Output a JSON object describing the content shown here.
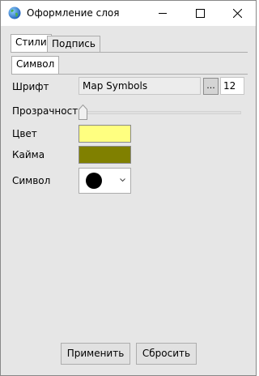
{
  "window": {
    "title": "Оформление слоя",
    "icons": {
      "app": "globe-icon",
      "minimize": "minimize-icon",
      "maximize": "maximize-icon",
      "close": "close-icon"
    }
  },
  "tabs": [
    {
      "label": "Стили",
      "active": true
    },
    {
      "label": "Подпись",
      "active": false
    }
  ],
  "subtabs": [
    {
      "label": "Символ",
      "active": true
    }
  ],
  "form": {
    "font_label": "Шрифт",
    "font_value": "Map Symbols",
    "font_browse_label": "...",
    "font_size": "12",
    "transparency_label": "Прозрачность",
    "transparency_value": 0,
    "color_label": "Цвет",
    "color_value": "#ffff80",
    "border_label": "Кайма",
    "border_value": "#808000",
    "symbol_label": "Символ",
    "symbol_value": "filled-circle-icon",
    "symbol_color": "#000000"
  },
  "buttons": {
    "apply_label": "Применить",
    "reset_label": "Сбросить"
  }
}
